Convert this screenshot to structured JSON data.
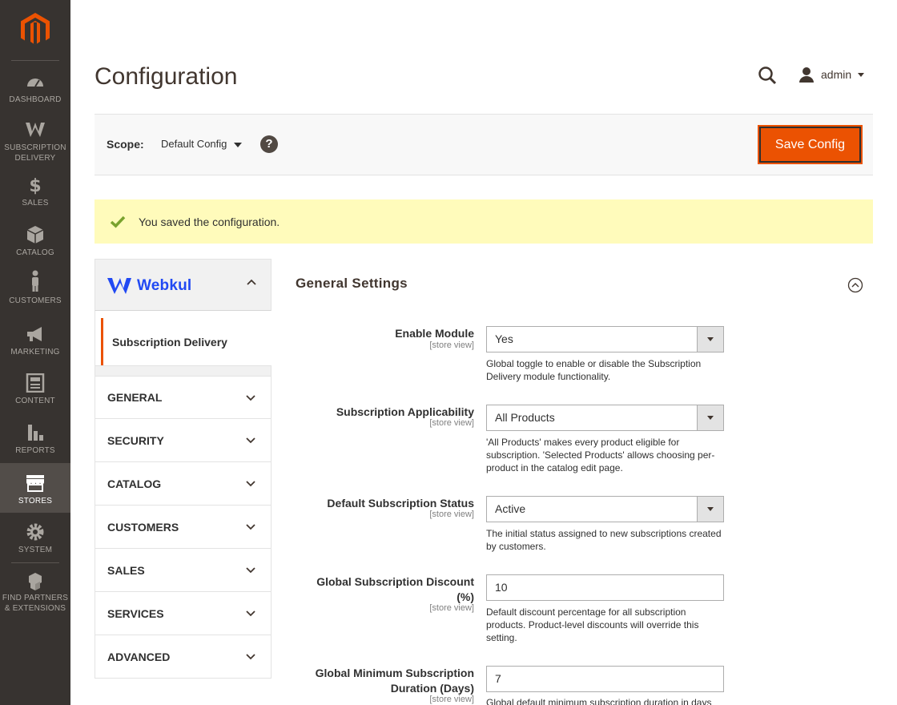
{
  "sidebar": {
    "items": [
      {
        "label": "DASHBOARD",
        "icon": "dashboard-icon"
      },
      {
        "label": "SUBSCRIPTION DELIVERY",
        "icon": "webkul-w-icon"
      },
      {
        "label": "SALES",
        "icon": "dollar-icon"
      },
      {
        "label": "CATALOG",
        "icon": "box-icon"
      },
      {
        "label": "CUSTOMERS",
        "icon": "person-icon"
      },
      {
        "label": "MARKETING",
        "icon": "megaphone-icon"
      },
      {
        "label": "CONTENT",
        "icon": "content-icon"
      },
      {
        "label": "REPORTS",
        "icon": "bar-chart-icon"
      },
      {
        "label": "STORES",
        "icon": "store-icon"
      },
      {
        "label": "SYSTEM",
        "icon": "gear-icon"
      },
      {
        "label": "FIND PARTNERS & EXTENSIONS",
        "icon": "blocks-icon"
      }
    ],
    "active": "STORES"
  },
  "header": {
    "title": "Configuration",
    "user": "admin"
  },
  "scope": {
    "label": "Scope:",
    "value": "Default Config",
    "help": "?",
    "save_label": "Save Config"
  },
  "message": {
    "text": "You saved the configuration."
  },
  "config_nav": {
    "vendor": "Webkul",
    "vendor_item": "Subscription Delivery",
    "sections": [
      "GENERAL",
      "SECURITY",
      "CATALOG",
      "CUSTOMERS",
      "SALES",
      "SERVICES",
      "ADVANCED"
    ]
  },
  "form": {
    "section_title": "General Settings",
    "fields": [
      {
        "label": "Enable Module",
        "scope": "[store view]",
        "value": "Yes",
        "note": "Global toggle to enable or disable the Subscription Delivery module functionality."
      },
      {
        "label": "Subscription Applicability",
        "scope": "[store view]",
        "value": "All Products",
        "note": "'All Products' makes every product eligible for subscription. 'Selected Products' allows choosing per-product in the catalog edit page."
      },
      {
        "label": "Default Subscription Status",
        "scope": "[store view]",
        "value": "Active",
        "note": "The initial status assigned to new subscriptions created by customers."
      },
      {
        "label": "Global Subscription Discount (%)",
        "scope": "[store view]",
        "value": "10",
        "note": "Default discount percentage for all subscription products. Product-level discounts will override this setting."
      },
      {
        "label": "Global Minimum Subscription Duration (Days)",
        "scope": "[store view]",
        "value": "7",
        "note": "Global default minimum subscription duration in days"
      }
    ]
  },
  "colors": {
    "sidebar_bg": "#373330",
    "accent": "#eb5202",
    "message_bg": "#fffbbb",
    "vendor_blue": "#2149f3"
  }
}
